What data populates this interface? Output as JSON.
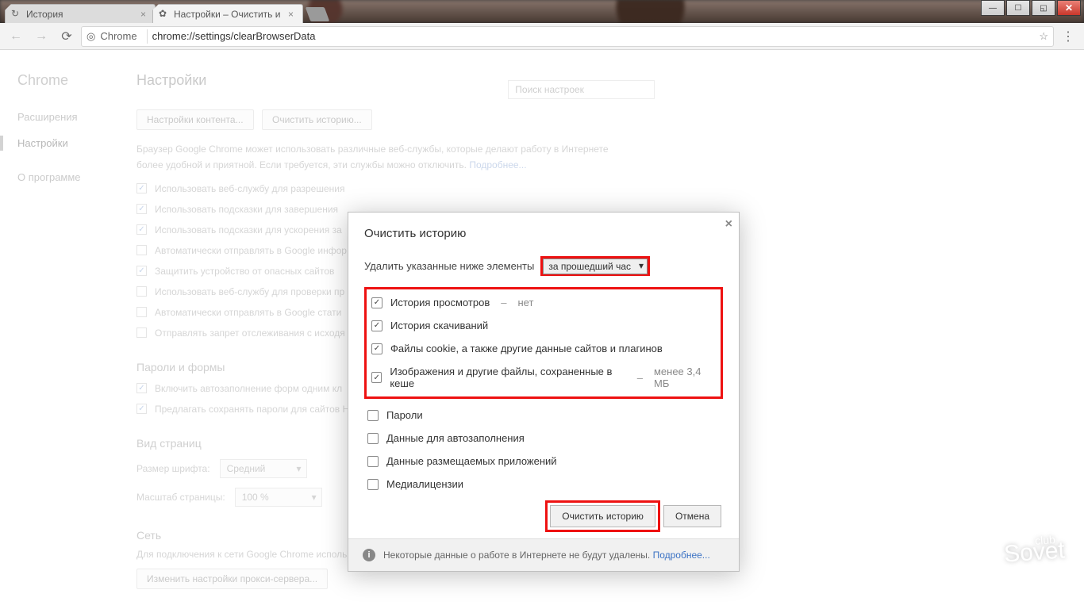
{
  "window": {
    "tabs": [
      {
        "icon": "↻",
        "label": "История"
      },
      {
        "icon": "✿",
        "label": "Настройки – Очистить и"
      }
    ]
  },
  "toolbar": {
    "security_label": "Chrome",
    "url": "chrome://settings/clearBrowserData"
  },
  "sidebar": {
    "brand": "Chrome",
    "items": [
      {
        "label": "Расширения"
      },
      {
        "label": "Настройки"
      },
      {
        "label": "О программе"
      }
    ]
  },
  "settings": {
    "title": "Настройки",
    "search_placeholder": "Поиск настроек",
    "btn_content": "Настройки контента...",
    "btn_clear": "Очистить историю...",
    "description": "Браузер Google Chrome может использовать различные веб-службы, которые делают работу в Интернете более удобной и приятной. Если требуется, эти службы можно отключить.",
    "desc_link": "Подробнее...",
    "privacy_checks": [
      {
        "checked": true,
        "label": "Использовать веб-службу для разрешения"
      },
      {
        "checked": true,
        "label": "Использовать подсказки для завершения"
      },
      {
        "checked": true,
        "label": "Использовать подсказки для ускорения за"
      },
      {
        "checked": false,
        "label": "Автоматически отправлять в Google инфор"
      },
      {
        "checked": true,
        "label": "Защитить устройство от опасных сайтов"
      },
      {
        "checked": false,
        "label": "Использовать веб-службу для проверки пр"
      },
      {
        "checked": false,
        "label": "Автоматически отправлять в Google стати"
      },
      {
        "checked": false,
        "label": "Отправлять запрет отслеживания с исходя"
      }
    ],
    "section_passwords": "Пароли и формы",
    "passwords_checks": [
      {
        "checked": true,
        "label": "Включить автозаполнение форм одним кл"
      },
      {
        "checked": true,
        "label": "Предлагать сохранять пароли для сайтов Н"
      }
    ],
    "section_appearance": "Вид страниц",
    "font_label": "Размер шрифта:",
    "font_value": "Средний",
    "zoom_label": "Масштаб страницы:",
    "zoom_value": "100 %",
    "section_network": "Сеть",
    "network_desc": "Для подключения к сети Google Chrome использует системные настройки прокси-сервера.",
    "btn_proxy": "Изменить настройки прокси-сервера..."
  },
  "dialog": {
    "title": "Очистить историю",
    "prompt": "Удалить указанные ниже элементы",
    "time_range": "за прошедший час",
    "options": [
      {
        "checked": true,
        "label": "История просмотров",
        "suffix": "нет"
      },
      {
        "checked": true,
        "label": "История скачиваний",
        "suffix": ""
      },
      {
        "checked": true,
        "label": "Файлы cookie, а также другие данные сайтов и плагинов",
        "suffix": ""
      },
      {
        "checked": true,
        "label": "Изображения и другие файлы, сохраненные в кеше",
        "suffix": "менее 3,4 МБ"
      },
      {
        "checked": false,
        "label": "Пароли",
        "suffix": ""
      },
      {
        "checked": false,
        "label": "Данные для автозаполнения",
        "suffix": ""
      },
      {
        "checked": false,
        "label": "Данные размещаемых приложений",
        "suffix": ""
      },
      {
        "checked": false,
        "label": "Медиалицензии",
        "suffix": ""
      }
    ],
    "btn_clear": "Очистить историю",
    "btn_cancel": "Отмена",
    "footer_text": "Некоторые данные о работе в Интернете не будут удалены.",
    "footer_link": "Подробнее..."
  },
  "watermark": {
    "small": "club",
    "big": "Sovet"
  }
}
